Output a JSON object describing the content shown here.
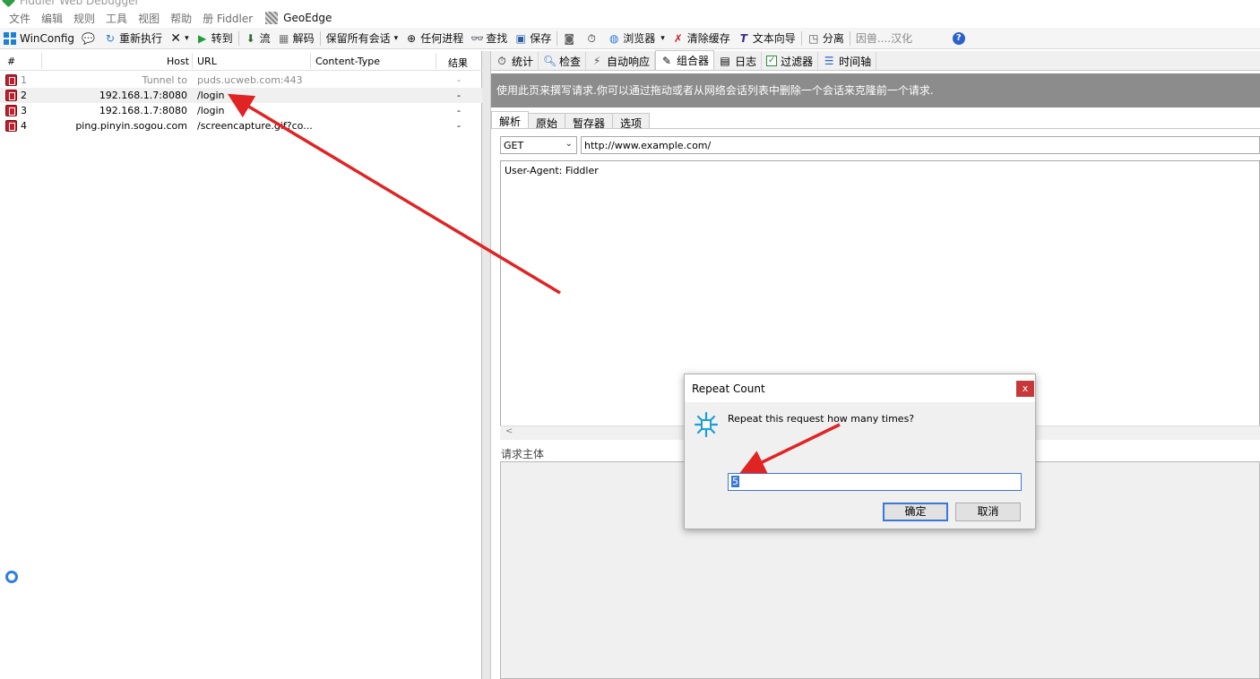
{
  "window": {
    "title": "Fiddler Web Debugger"
  },
  "menu": [
    "文件",
    "编辑",
    "规则",
    "工具",
    "视图",
    "帮助",
    "册 Fiddler"
  ],
  "menu_extra": "GeoEdge",
  "toolbar": {
    "winconfig": "WinConfig",
    "replay": "重新执行",
    "go": "转到",
    "stream": "流",
    "decode": "解码",
    "keep_sessions": "保留所有会话",
    "any_process": "任何进程",
    "find": "查找",
    "save": "保存",
    "browser": "浏览器",
    "clear_cache": "清除缓存",
    "text_wizard": "文本向导",
    "tearoff": "分离",
    "localize": "因兽....汉化"
  },
  "sessions": {
    "columns": [
      "#",
      "Host",
      "URL",
      "Content-Type",
      "结果"
    ],
    "rows": [
      {
        "num": "1",
        "host": "Tunnel to",
        "url": "puds.ucweb.com:443",
        "content_type": "",
        "result": "-"
      },
      {
        "num": "2",
        "host": "192.168.1.7:8080",
        "url": "/login",
        "content_type": "",
        "result": "-"
      },
      {
        "num": "3",
        "host": "192.168.1.7:8080",
        "url": "/login",
        "content_type": "",
        "result": "-"
      },
      {
        "num": "4",
        "host": "ping.pinyin.sogou.com",
        "url": "/screencapture.gif?co...",
        "content_type": "",
        "result": "-"
      }
    ]
  },
  "tabs": [
    "统计",
    "检查",
    "自动响应",
    "组合器",
    "日志",
    "过滤器",
    "时间轴"
  ],
  "composer": {
    "info": "使用此页来撰写请求.你可以通过拖动或者从网络会话列表中删除一个会话来克隆前一个请求.",
    "subtabs": [
      "解析",
      "原始",
      "暂存器",
      "选项"
    ],
    "method": "GET",
    "url": "http://www.example.com/",
    "headers": "User-Agent: Fiddler",
    "scroll_left": "<",
    "body_label": "请求主体"
  },
  "dialog": {
    "title": "Repeat Count",
    "close": "x",
    "message": "Repeat this request how many times?",
    "value": "5",
    "ok": "确定",
    "cancel": "取消"
  },
  "colors": {
    "accent_red": "#e02424",
    "info_bar": "#8c8c8c",
    "selection": "#3a78d6"
  }
}
